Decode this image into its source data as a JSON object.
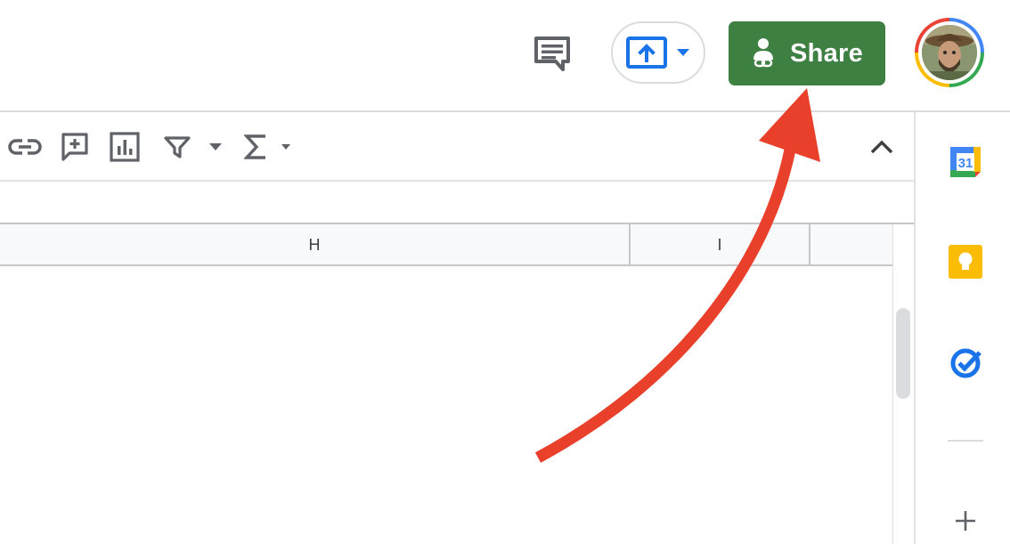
{
  "header": {
    "share_label": "Share",
    "comments_icon": "comments-icon",
    "present_icon": "present-upload-icon",
    "share_icon": "person-link-icon",
    "avatar": "user-avatar-photo"
  },
  "toolbar": {
    "items": [
      {
        "name": "insert-link",
        "icon": "link-icon"
      },
      {
        "name": "insert-comment",
        "icon": "add-comment-icon"
      },
      {
        "name": "insert-chart",
        "icon": "chart-icon"
      },
      {
        "name": "create-filter",
        "icon": "filter-icon"
      },
      {
        "name": "filter-dropdown",
        "icon": "chevron-down-icon"
      },
      {
        "name": "functions",
        "icon": "sigma-icon"
      },
      {
        "name": "functions-dropdown",
        "icon": "chevron-down-icon"
      },
      {
        "name": "hide-menus",
        "icon": "chevron-up-icon"
      }
    ]
  },
  "grid": {
    "columns": [
      {
        "label": "H"
      },
      {
        "label": "I"
      }
    ]
  },
  "sidepanel": {
    "calendar_day": "31",
    "items": [
      {
        "name": "calendar",
        "icon": "calendar-icon"
      },
      {
        "name": "keep",
        "icon": "keep-icon"
      },
      {
        "name": "tasks",
        "icon": "tasks-icon"
      },
      {
        "name": "add-addon",
        "icon": "plus-icon"
      }
    ]
  },
  "colors": {
    "share_green": "#3e7f42",
    "accent_blue": "#1a73e8",
    "annotation_red": "#e8402a",
    "keep_yellow": "#fbbc04"
  }
}
